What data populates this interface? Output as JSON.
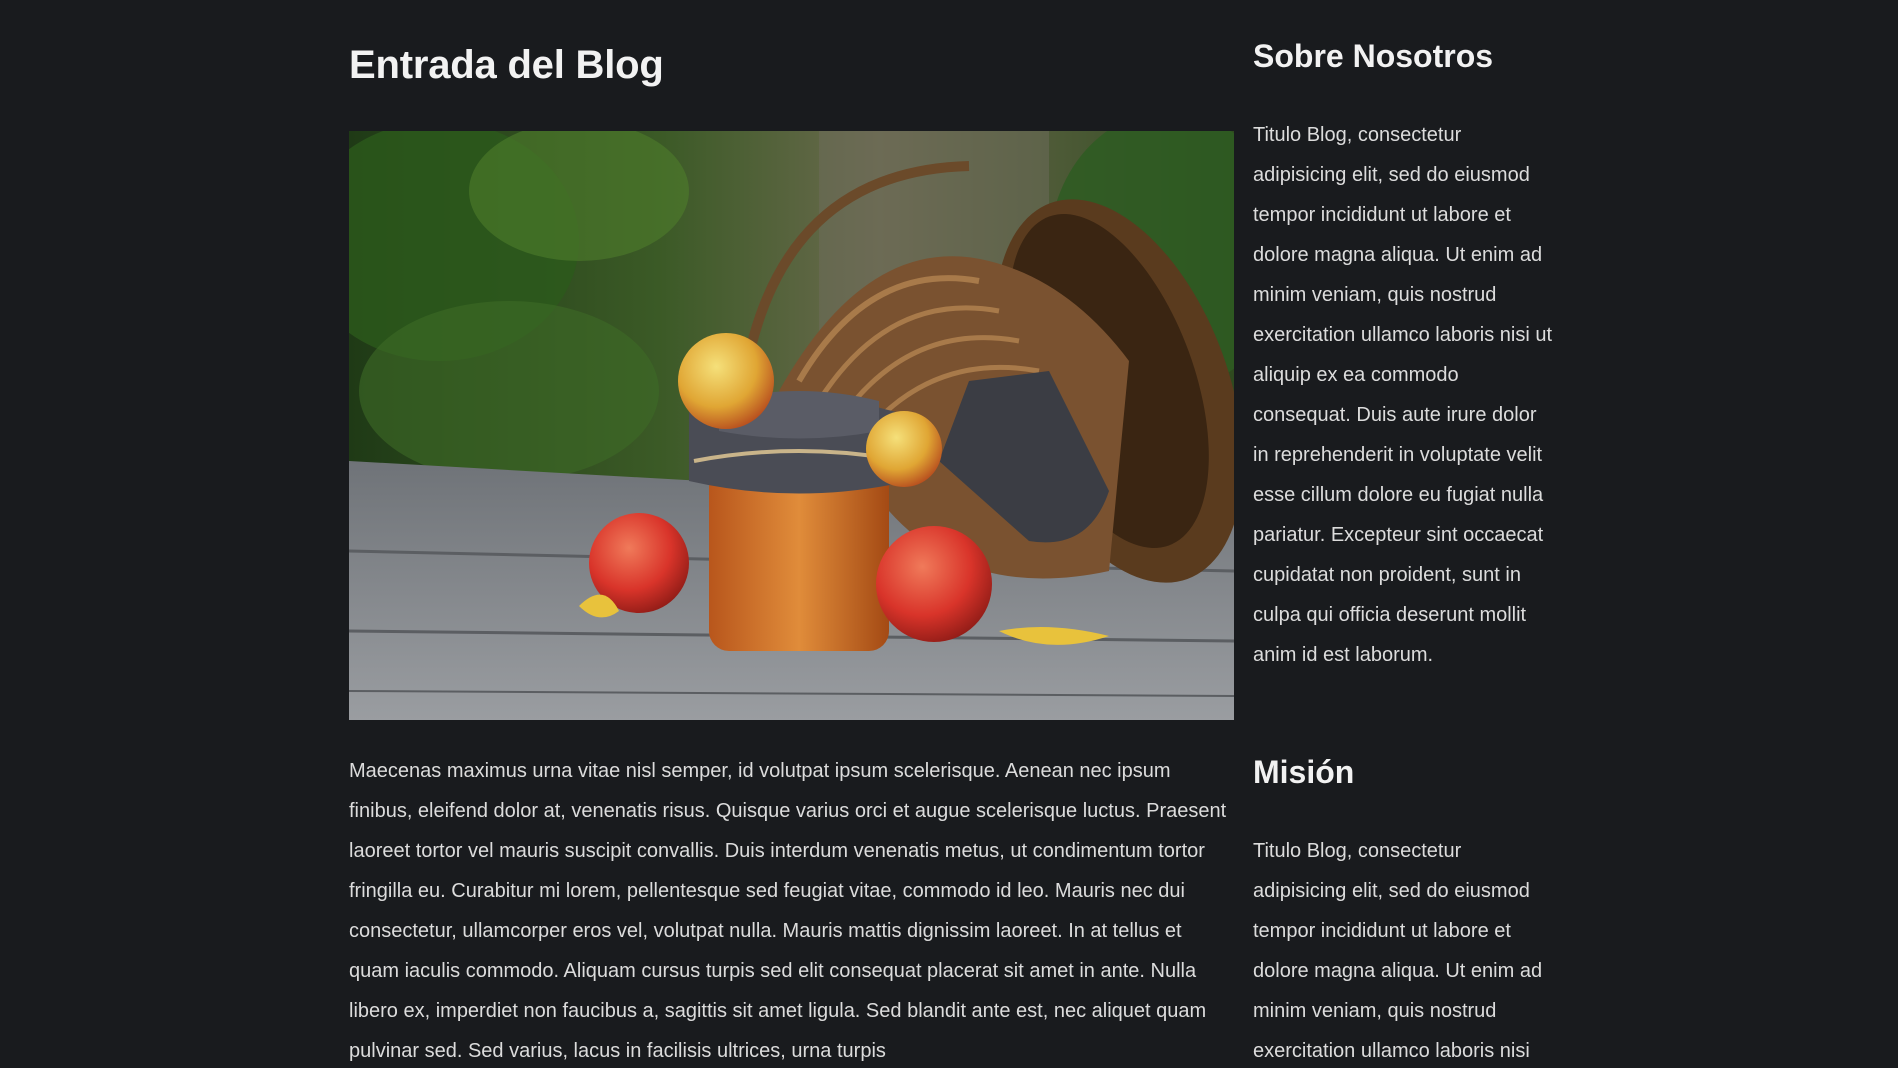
{
  "post": {
    "title": "Entrada del Blog",
    "image_alt": "Frasco de mermelada con manzanas y una cesta de mimbre sobre una mesa de madera",
    "body": "Maecenas maximus urna vitae nisl semper, id volutpat ipsum scelerisque. Aenean nec ipsum finibus, eleifend dolor at, venenatis risus. Quisque varius orci et augue scelerisque luctus. Praesent laoreet tortor vel mauris suscipit convallis. Duis interdum venenatis metus, ut condimentum tortor fringilla eu. Curabitur mi lorem, pellentesque sed feugiat vitae, commodo id leo. Mauris nec dui consectetur, ullamcorper eros vel, volutpat nulla. Mauris mattis dignissim laoreet. In at tellus et quam iaculis commodo. Aliquam cursus turpis sed elit consequat placerat sit amet in ante. Nulla libero ex, imperdiet non faucibus a, sagittis sit amet ligula. Sed blandit ante est, nec aliquet quam pulvinar sed. Sed varius, lacus in facilisis ultrices, urna turpis"
  },
  "sidebar": {
    "about": {
      "heading": "Sobre Nosotros",
      "text": "Titulo Blog, consectetur adipisicing elit, sed do eiusmod tempor incididunt ut labore et dolore magna aliqua. Ut enim ad minim veniam, quis nostrud exercitation ullamco laboris nisi ut aliquip ex ea commodo consequat. Duis aute irure dolor in reprehenderit in voluptate velit esse cillum dolore eu fugiat nulla pariatur. Excepteur sint occaecat cupidatat non proident, sunt in culpa qui officia deserunt mollit anim id est laborum."
    },
    "mision": {
      "heading": "Misión",
      "text": "Titulo Blog, consectetur adipisicing elit, sed do eiusmod tempor incididunt ut labore et dolore magna aliqua. Ut enim ad minim veniam, quis nostrud exercitation ullamco laboris nisi"
    }
  },
  "colors": {
    "background": "#191b1e",
    "text": "#dcdcdc",
    "heading": "#f2f2f2"
  }
}
